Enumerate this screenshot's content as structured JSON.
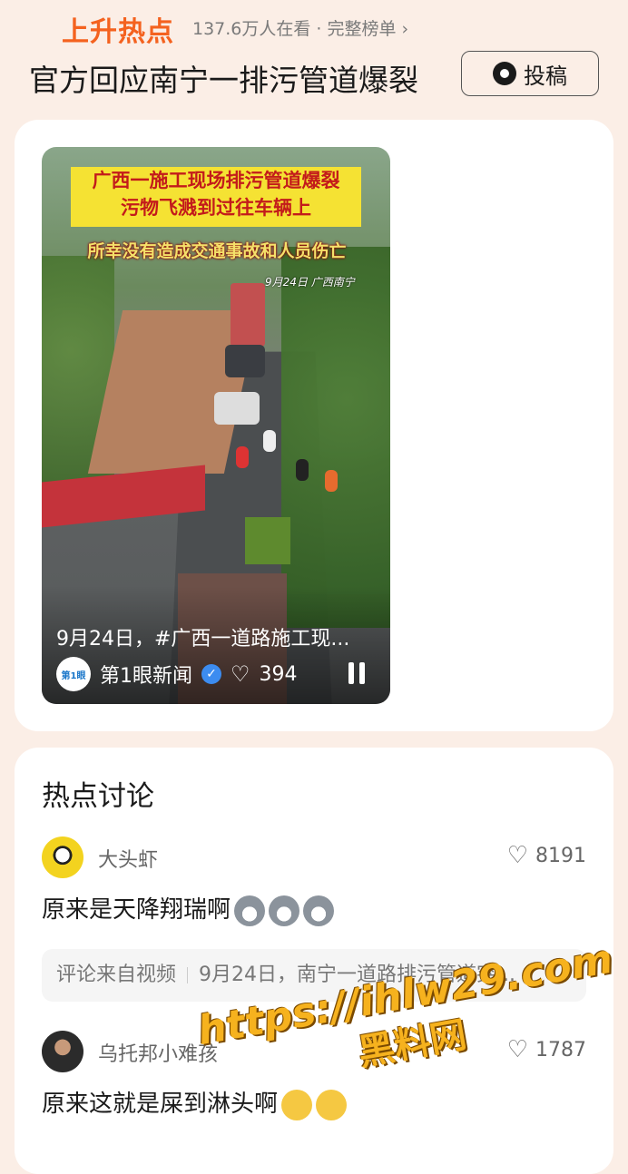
{
  "header": {
    "hot_label": "上升热点",
    "viewers": "137.6万人在看 · 完整榜单",
    "headline": "官方回应南宁一排污管道爆裂",
    "post_button": "投稿"
  },
  "video": {
    "banner_line1": "广西一施工现场排污管道爆裂",
    "banner_line2": "污物飞溅到过往车辆上",
    "banner_line3": "所幸没有造成交通事故和人员伤亡",
    "stamp": "9月24日 广西南宁",
    "caption": "9月24日，#广西一道路施工现...",
    "author": "第1眼新闻",
    "author_avatar_text": "第1眼",
    "likes": "394"
  },
  "discussion": {
    "title": "热点讨论",
    "comments": [
      {
        "user": "大头虾",
        "likes": "8191",
        "text": "原来是天降翔瑞啊",
        "emoji_count": 3,
        "source_label": "评论来自视频",
        "source_title": "9月24日，南宁一道路排污管道突..."
      },
      {
        "user": "乌托邦小难孩",
        "likes": "1787",
        "text": "原来这就是屎到淋头啊",
        "emoji_count": 2
      }
    ]
  },
  "watermark": {
    "url": "https://ihlw29.com",
    "name": "黑料网"
  },
  "colors": {
    "accent": "#f4621f",
    "page_bg": "#fbeee6",
    "verified": "#3c8cf0"
  }
}
